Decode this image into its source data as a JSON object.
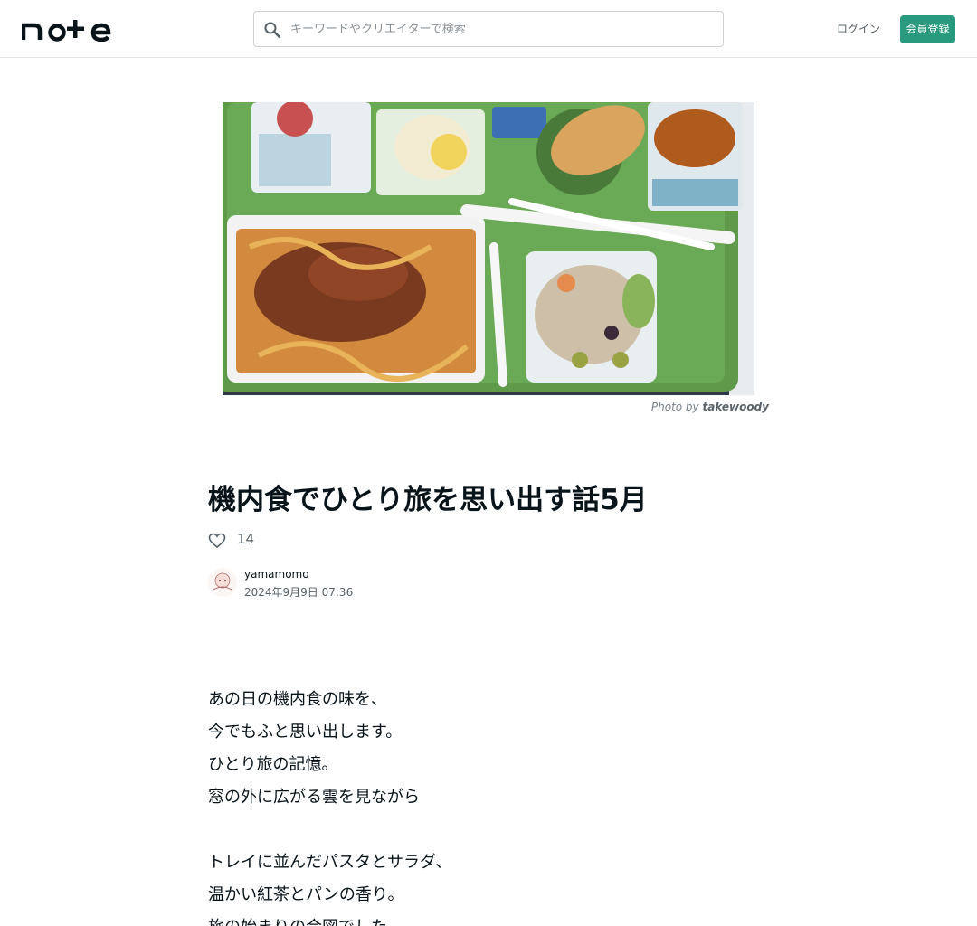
{
  "header": {
    "logo_text": "note",
    "search": {
      "placeholder": "キーワードやクリエイターで検索"
    },
    "login_label": "ログイン",
    "signup_label": "会員登録",
    "accent_color": "#2a9a7e"
  },
  "hero": {
    "credit_prefix": "Photo by",
    "credit_author": "takewoody"
  },
  "article": {
    "title": "機内食でひとり旅を思い出す話5月",
    "likes": "14",
    "author": "yamamomo",
    "date": "2024年9月9日 07:36",
    "paragraphs": [
      [
        "あの日の機内食の味を、",
        "今でもふと思い出します。",
        "ひとり旅の記憶。",
        "窓の外に広がる雲を見ながら"
      ],
      [
        "トレイに並んだパスタとサラダ、",
        "温かい紅茶とパンの香り。",
        "旅の始まりの合図でした。"
      ]
    ]
  },
  "icons": {
    "search": "search-icon",
    "heart": "heart-icon",
    "avatar": "avatar-image"
  }
}
